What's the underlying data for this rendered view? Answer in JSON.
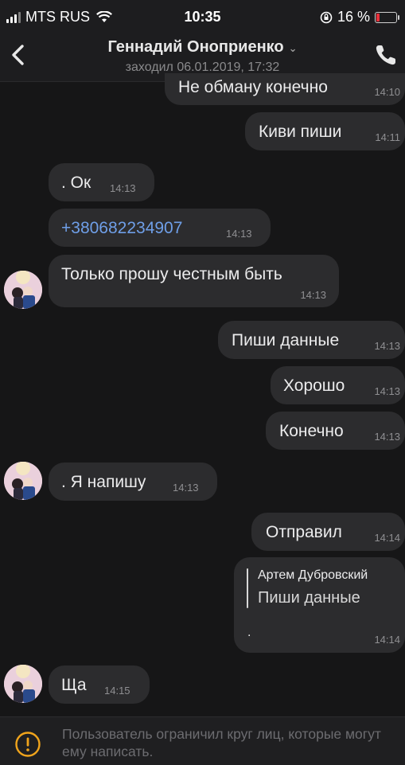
{
  "status_bar": {
    "carrier": "MTS RUS",
    "time": "10:35",
    "battery": "16 %",
    "battery_level": 0.16,
    "battery_color": "#e8303a"
  },
  "header": {
    "contact_name": "Геннадий Оноприенко",
    "last_seen": "заходил 06.01.2019, 17:32",
    "icons": [
      "back-arrow",
      "chevron-down",
      "phone"
    ]
  },
  "messages": [
    {
      "direction": "out",
      "text": "Не обману конечно",
      "time": "14:10"
    },
    {
      "direction": "out",
      "text": "Киви пиши",
      "time": "14:11"
    },
    {
      "direction": "in",
      "text": ". Ок",
      "time": "14:13"
    },
    {
      "direction": "in",
      "text": "+380682234907",
      "time": "14:13",
      "link": true
    },
    {
      "direction": "in",
      "text": "Только прошу честным  быть",
      "time": "14:13",
      "avatar": true
    },
    {
      "direction": "out",
      "text": "Пиши данные",
      "time": "14:13"
    },
    {
      "direction": "out",
      "text": "Хорошо",
      "time": "14:13"
    },
    {
      "direction": "out",
      "text": "Конечно",
      "time": "14:13"
    },
    {
      "direction": "in",
      "text": ". Я напишу",
      "time": "14:13",
      "avatar": true
    },
    {
      "direction": "out",
      "text": "Отправил",
      "time": "14:14"
    },
    {
      "direction": "out",
      "reply_author": "Артем Дубровский",
      "reply_text": "Пиши данные",
      "text": ".",
      "time": "14:14"
    },
    {
      "direction": "in",
      "text": "Ща",
      "time": "14:15",
      "avatar": true
    }
  ],
  "notice": {
    "text": "Пользователь ограничил круг лиц, которые могут ему написать.",
    "icon": "warning-circle",
    "icon_color": "#f0a41c"
  },
  "colors": {
    "background": "#161617",
    "bubble": "#2c2c2e",
    "link": "#6f9fe8"
  }
}
